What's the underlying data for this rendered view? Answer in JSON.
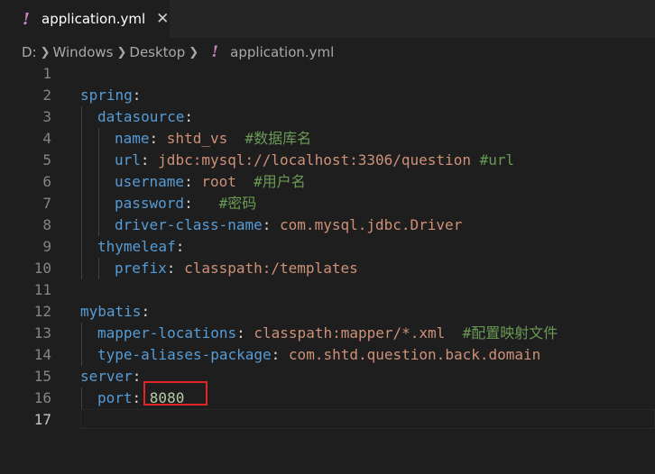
{
  "tab": {
    "title": "application.yml",
    "close_glyph": "✕",
    "icon": "yaml-file-icon"
  },
  "breadcrumb": {
    "drive": "D:",
    "items": [
      "Windows",
      "Desktop"
    ],
    "file": "application.yml"
  },
  "colors": {
    "background": "#1e1e1e",
    "key": "#569cd6",
    "string": "#ce9178",
    "number": "#b5cea8",
    "comment": "#6a9955",
    "highlight_border": "#e0252a"
  },
  "editor": {
    "current_line": 17,
    "lines": [
      {
        "n": "1",
        "key": "",
        "value": "",
        "comment": ""
      },
      {
        "n": "2",
        "key": "spring",
        "value": "",
        "comment": ""
      },
      {
        "n": "3",
        "key": "datasource",
        "value": "",
        "comment": ""
      },
      {
        "n": "4",
        "key": "name",
        "value": "shtd_vs",
        "comment": "#数据库名"
      },
      {
        "n": "5",
        "key": "url",
        "value": "jdbc:mysql://localhost:3306/question",
        "comment": "#url"
      },
      {
        "n": "6",
        "key": "username",
        "value": "root",
        "comment": "#用户名"
      },
      {
        "n": "7",
        "key": "password",
        "value": "",
        "comment": "#密码"
      },
      {
        "n": "8",
        "key": "driver-class-name",
        "value": "com.mysql.jdbc.Driver",
        "comment": ""
      },
      {
        "n": "9",
        "key": "thymeleaf",
        "value": "",
        "comment": ""
      },
      {
        "n": "10",
        "key": "prefix",
        "value": "classpath:/templates",
        "comment": ""
      },
      {
        "n": "11",
        "key": "",
        "value": "",
        "comment": ""
      },
      {
        "n": "12",
        "key": "mybatis",
        "value": "",
        "comment": ""
      },
      {
        "n": "13",
        "key": "mapper-locations",
        "value": "classpath:mapper/*.xml",
        "comment": "#配置映射文件"
      },
      {
        "n": "14",
        "key": "type-aliases-package",
        "value": "com.shtd.question.back.domain",
        "comment": ""
      },
      {
        "n": "15",
        "key": "server",
        "value": "",
        "comment": ""
      },
      {
        "n": "16",
        "key": "port",
        "value": "8080",
        "comment": ""
      },
      {
        "n": "17",
        "key": "",
        "value": "",
        "comment": ""
      }
    ]
  }
}
